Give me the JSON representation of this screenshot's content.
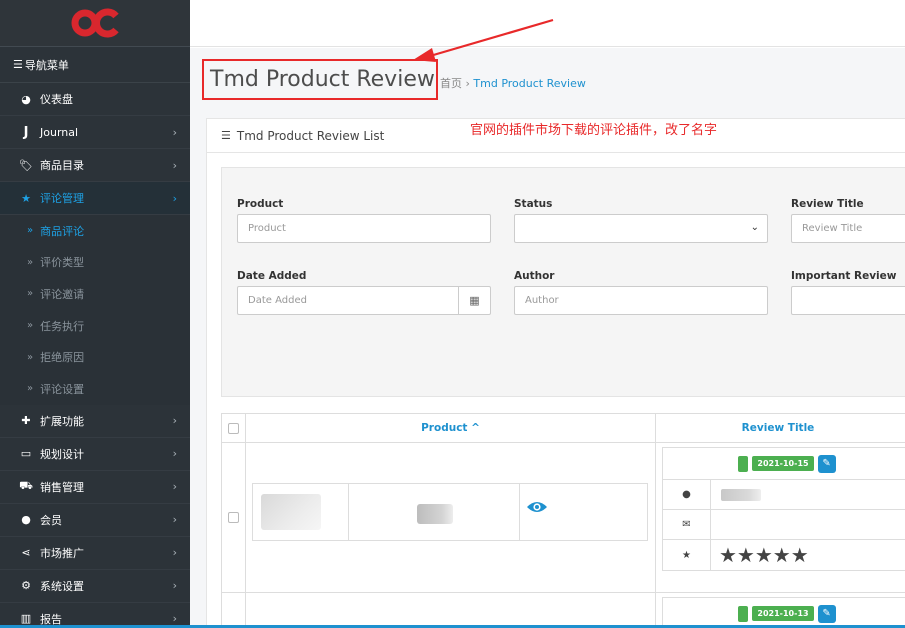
{
  "sidebar": {
    "logo": "OC",
    "nav_header": "导航菜单",
    "items": [
      {
        "label": "仪表盘",
        "icon": "dashboard-icon",
        "has_chevron": false
      },
      {
        "label": "Journal",
        "icon": "j-icon",
        "has_chevron": true
      },
      {
        "label": "商品目录",
        "icon": "tag-icon",
        "has_chevron": true
      },
      {
        "label": "评论管理",
        "icon": "star-icon",
        "has_chevron": true,
        "active": true
      }
    ],
    "sub_items": [
      {
        "label": "商品评论",
        "active": true
      },
      {
        "label": "评价类型"
      },
      {
        "label": "评论邀请"
      },
      {
        "label": "任务执行"
      },
      {
        "label": "拒绝原因"
      },
      {
        "label": "评论设置"
      }
    ],
    "items_after": [
      {
        "label": "扩展功能",
        "icon": "puzzle-icon"
      },
      {
        "label": "规划设计",
        "icon": "monitor-icon"
      },
      {
        "label": "销售管理",
        "icon": "cart-icon"
      },
      {
        "label": "会员",
        "icon": "user-icon"
      },
      {
        "label": "市场推广",
        "icon": "share-icon"
      },
      {
        "label": "系统设置",
        "icon": "cog-icon"
      },
      {
        "label": "报告",
        "icon": "bar-chart-icon"
      }
    ]
  },
  "header": {
    "page_title": "Tmd Product Review",
    "breadcrumb_home": "首页",
    "breadcrumb_sep": "›",
    "breadcrumb_current": "Tmd Product Review"
  },
  "annotation": "官网的插件市场下载的评论插件，改了名字",
  "panel": {
    "heading": "Tmd Product Review List"
  },
  "filters": {
    "product_label": "Product",
    "product_placeholder": "Product",
    "status_label": "Status",
    "status_value": "",
    "review_title_label": "Review Title",
    "review_title_placeholder": "Review Title",
    "date_added_label": "Date Added",
    "date_added_placeholder": "Date Added",
    "author_label": "Author",
    "author_placeholder": "Author",
    "important_review_label": "Important Review"
  },
  "table": {
    "col_product": "Product ^",
    "col_review_title": "Review Title",
    "rows": [
      {
        "date": "2021-10-15",
        "stars": "★★★★★"
      },
      {
        "date": "2021-10-13"
      }
    ]
  },
  "colors": {
    "sidebar_bg": "#2c3339",
    "accent": "#1ea1e4",
    "link": "#1e91cf",
    "annotation": "#e8292a",
    "badge_green": "#4caf50"
  }
}
